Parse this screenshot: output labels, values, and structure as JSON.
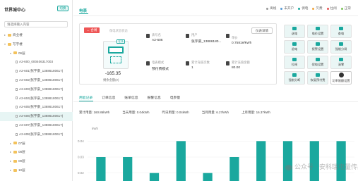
{
  "sidebar": {
    "title": "世界城中心",
    "toggle_label": "切换",
    "search_placeholder": "请选择输入内容",
    "tree": [
      {
        "label": "商业楼",
        "level": 0,
        "type": "folder",
        "expanded": false
      },
      {
        "label": "写字楼",
        "level": 0,
        "type": "folder",
        "expanded": true
      },
      {
        "label": "06层",
        "level": 1,
        "type": "folder",
        "expanded": true
      },
      {
        "label": "A2-600_000406317003",
        "level": 2,
        "type": "meter"
      },
      {
        "label": "A2-601(张宇豪_13886180617)",
        "level": 2,
        "type": "meter"
      },
      {
        "label": "A2-602(张宇豪_13886180617)",
        "level": 2,
        "type": "meter"
      },
      {
        "label": "A2-603(张宇豪_13886180617)",
        "level": 2,
        "type": "meter"
      },
      {
        "label": "A2-604(张宇豪_13886180617)",
        "level": 2,
        "type": "meter"
      },
      {
        "label": "A2-605(张宇豪_13886180617)",
        "level": 2,
        "type": "meter"
      },
      {
        "label": "A2-606(张宇豪_13886180617)",
        "level": 2,
        "type": "meter",
        "active": true
      },
      {
        "label": "A2-607(张宇豪_13886180617)",
        "level": 2,
        "type": "meter"
      },
      {
        "label": "A2-608(张宇豪_13886180617)",
        "level": 2,
        "type": "meter"
      },
      {
        "label": "07层",
        "level": 1,
        "type": "folder",
        "expanded": false
      },
      {
        "label": "08层",
        "level": 1,
        "type": "folder",
        "expanded": false
      },
      {
        "label": "09层",
        "level": 1,
        "type": "folder",
        "expanded": false
      },
      {
        "label": "10层",
        "level": 1,
        "type": "folder",
        "expanded": false
      }
    ]
  },
  "header": {
    "tab_label": "电表",
    "legend": [
      {
        "label": "离线",
        "color": "#999999"
      },
      {
        "label": "未开户",
        "color": "#5b9bd5"
      },
      {
        "label": "保电",
        "color": "#1aa89e"
      },
      {
        "label": "欠费",
        "color": "#f0a640"
      },
      {
        "label": "拉闸",
        "color": "#e55555"
      },
      {
        "label": "正常",
        "color": "#7cc35b"
      }
    ]
  },
  "card": {
    "back_label": "← 合闸",
    "device_status": "保电状态状态",
    "online_tag": "在线",
    "balance_value": "-165.35",
    "balance_label": "剩余金额(¥)",
    "history_button": "仪表详情",
    "fields": {
      "meter_name_label": "表号名",
      "meter_name_value": "A2-606",
      "user_label": "用户",
      "user_value": "张宇豪_13886180...",
      "rate_label": "单价",
      "rate_value": "0.7581¥/kWh",
      "mode_label": "电表模式",
      "mode_value": "预付费模式",
      "recharge_count_label": "累计充值次数",
      "recharge_count_value": "1",
      "recharge_amount_label": "累计充值金额",
      "recharge_amount_value": "80.00"
    }
  },
  "actions": [
    {
      "label": "送电"
    },
    {
      "label": "电价设置"
    },
    {
      "label": "查电"
    },
    {
      "label": "退电"
    },
    {
      "label": "报警设置"
    },
    {
      "label": "强制分闸"
    },
    {
      "label": "拉闸"
    },
    {
      "label": "保电设置"
    },
    {
      "label": "清零"
    },
    {
      "label": "强制分断"
    },
    {
      "label": "恢复预付费"
    },
    {
      "label": "功率限额设置",
      "highlight": true
    }
  ],
  "sub_tabs": [
    {
      "label": "用能记录",
      "active": true
    },
    {
      "label": "订单信息",
      "active": false
    },
    {
      "label": "账单信息",
      "active": false
    },
    {
      "label": "报警信息",
      "active": false
    },
    {
      "label": "电参量",
      "active": false
    }
  ],
  "stats": [
    {
      "label": "累计用量: 160.86kWh"
    },
    {
      "label": "当天用量: 0.04kWh"
    },
    {
      "label": "昨日用量: 0.04kWh"
    },
    {
      "label": "当月用量: 6.27kWh"
    },
    {
      "label": "上月用量: 16.37kWh"
    }
  ],
  "chart_data": {
    "type": "bar",
    "ylabel": "kWh",
    "yticks": [
      "0.04",
      "0.03",
      "0.02"
    ],
    "ylim": [
      0.015,
      0.045
    ],
    "values": [
      0.03,
      0.03,
      0.02,
      0.04,
      0.02,
      0.03,
      0.04,
      0.04,
      0.04,
      0.04
    ],
    "bar_color": "#1aa89e"
  },
  "watermark": "公众号 · 安科瑞电量传感器"
}
